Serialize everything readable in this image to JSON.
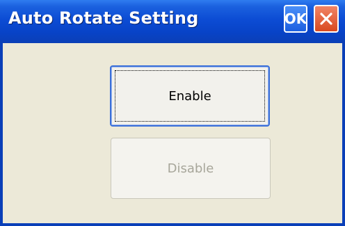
{
  "window": {
    "title": "Auto Rotate Setting",
    "ok_label": "OK",
    "close_icon": "close-icon"
  },
  "buttons": {
    "enable_label": "Enable",
    "disable_label": "Disable",
    "disable_enabled": false
  },
  "colors": {
    "titlebar": "#0843c7",
    "window_bg": "#ece9d8",
    "close_button": "#d9491f",
    "focus_border": "#3a6fd8",
    "disabled_text": "#a7a69a"
  }
}
